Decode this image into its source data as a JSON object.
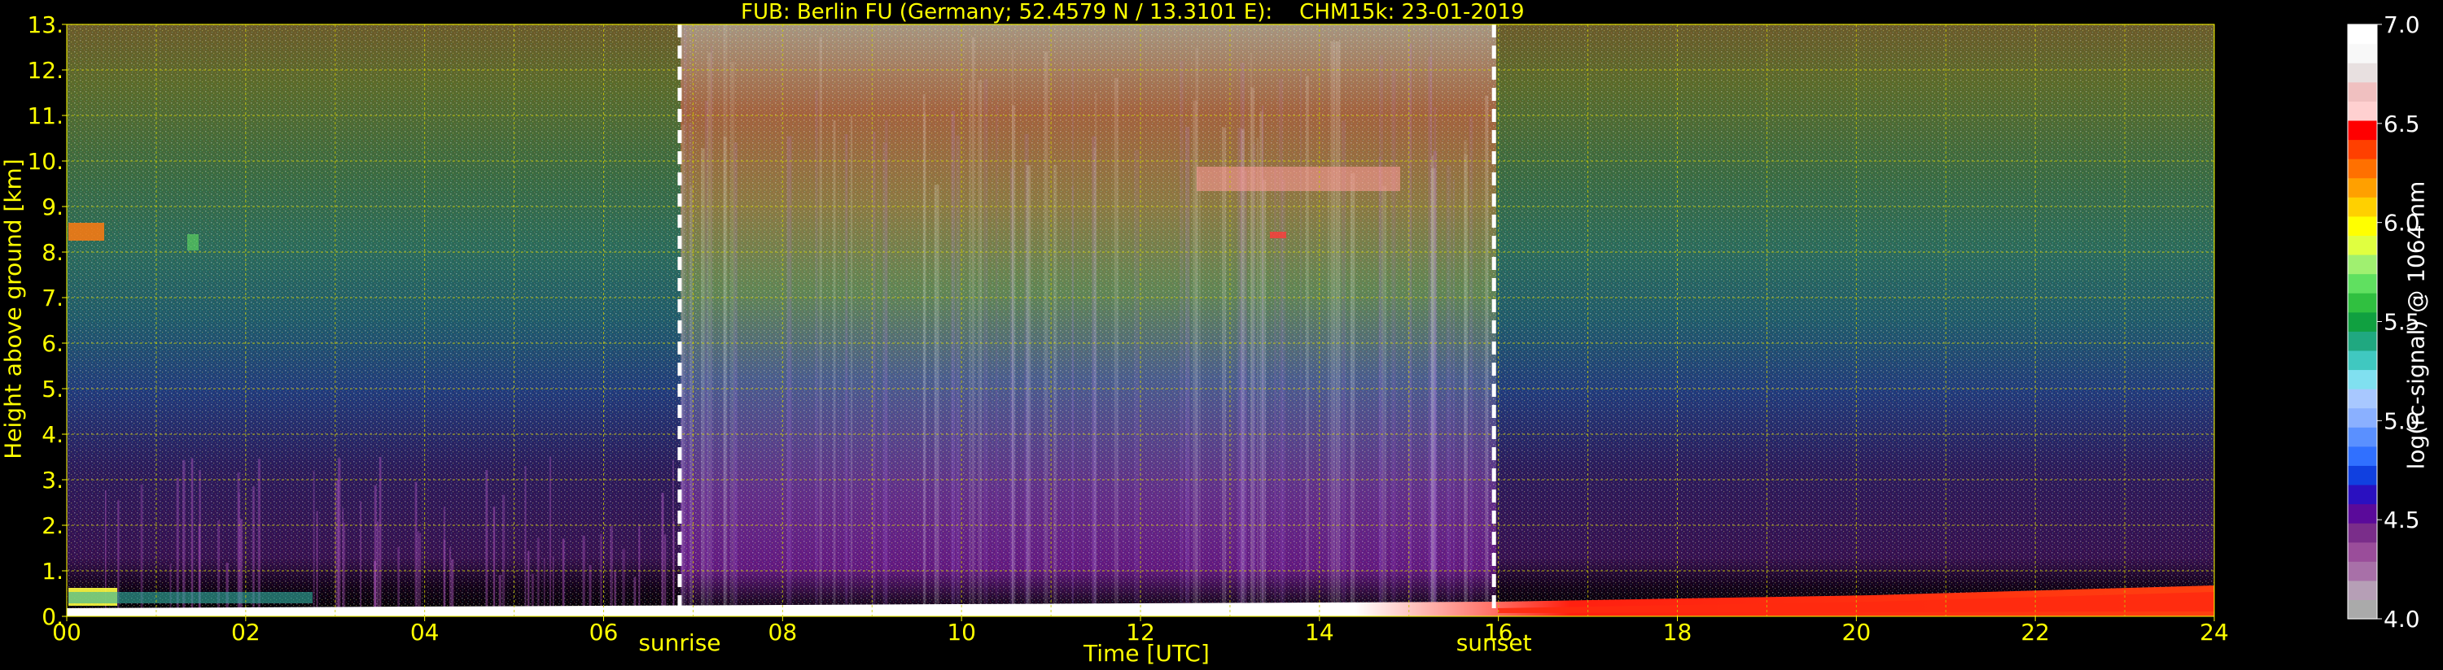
{
  "chart_data": {
    "type": "heatmap",
    "title": "FUB: Berlin FU (Germany; 52.4579 N / 13.3101 E):    CHM15k: 23-01-2019",
    "xlabel": "Time [UTC]",
    "ylabel": "Height above ground [km]",
    "xlim": [
      0,
      24
    ],
    "ylim": [
      0,
      13
    ],
    "x_ticks": [
      "00",
      "02",
      "04",
      "06",
      "08",
      "10",
      "12",
      "14",
      "16",
      "18",
      "20",
      "22",
      "24"
    ],
    "y_ticks": [
      "0.",
      "1.",
      "2.",
      "3.",
      "4.",
      "5.",
      "6.",
      "7.",
      "8.",
      "9.",
      "10.",
      "11.",
      "12.",
      "13."
    ],
    "grid": true,
    "colorbar": {
      "label": "log(rc-signal) @ 1064 nm",
      "range": [
        4.0,
        7.0
      ],
      "ticks": [
        "4.0",
        "4.5",
        "5.0",
        "5.5",
        "6.0",
        "6.5",
        "7.0"
      ],
      "colors": [
        "#aaaaaa",
        "#b69fb6",
        "#a870a8",
        "#9a4d9a",
        "#7a2d8a",
        "#5a0a9a",
        "#2a10c0",
        "#1040e0",
        "#3070ff",
        "#5a90ff",
        "#8ab0ff",
        "#a8c8ff",
        "#80e0f0",
        "#40c8c0",
        "#20a880",
        "#10a040",
        "#30c040",
        "#60e060",
        "#a0f070",
        "#e0ff40",
        "#ffff00",
        "#ffd000",
        "#ffa000",
        "#ff7000",
        "#ff4000",
        "#ff0000",
        "#ffd0d0",
        "#f0c0c0",
        "#e8e0e0",
        "#f8f8f8",
        "#ffffff"
      ]
    },
    "markers": [
      {
        "label": "sunrise",
        "x": 6.85
      },
      {
        "label": "sunset",
        "x": 15.95
      }
    ]
  }
}
